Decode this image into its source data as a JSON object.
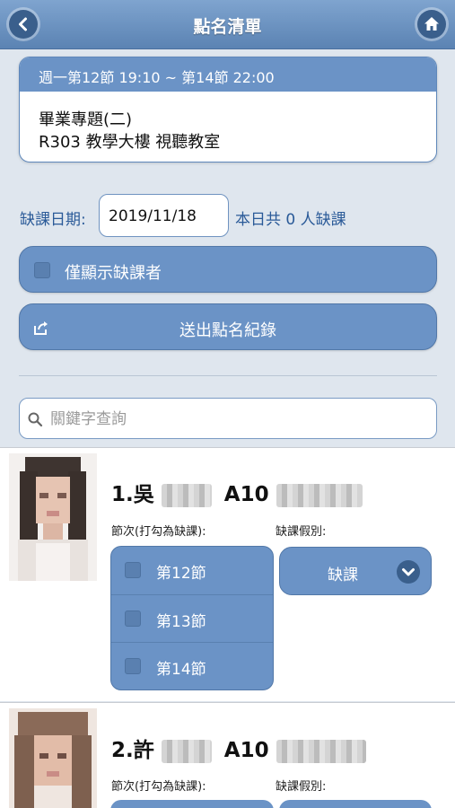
{
  "header": {
    "title": "點名清單"
  },
  "course": {
    "schedule": "週一第12節 19:10 ~ 第14節 22:00",
    "name": "畢業專題(二)",
    "room": "R303 教學大樓 視聽教室"
  },
  "absence": {
    "date_label": "缺課日期:",
    "date_value": "2019/11/18",
    "summary": "本日共 0 人缺課"
  },
  "filter": {
    "only_absent_label": "僅顯示缺課者"
  },
  "actions": {
    "send_label": "送出點名紀錄"
  },
  "search": {
    "placeholder": "關鍵字查詢"
  },
  "students": [
    {
      "name": "1.吳",
      "id_prefix": "A10",
      "periods_label": "節次(打勾為缺課):",
      "reason_label": "缺課假別:",
      "periods": [
        "第12節",
        "第13節",
        "第14節"
      ],
      "reason": "缺課"
    },
    {
      "name": "2.許",
      "id_prefix": "A10",
      "periods_label": "節次(打勾為缺課):",
      "reason_label": "缺課假別:"
    }
  ],
  "colors": {
    "accent": "#6b93c6",
    "header": "#5b83b3",
    "text_blue": "#2a5a98"
  }
}
